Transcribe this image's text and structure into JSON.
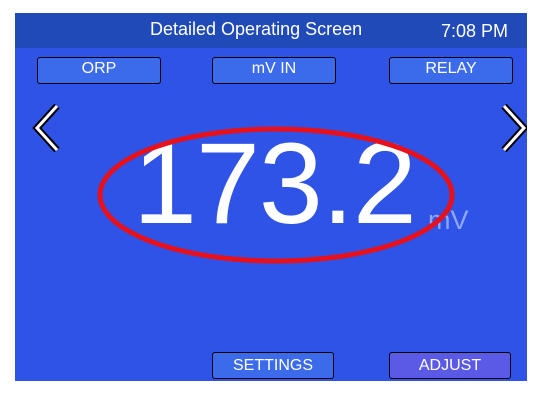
{
  "header": {
    "title": "Detailed Operating Screen",
    "time": "7:08 PM"
  },
  "tabs": [
    {
      "label": "ORP"
    },
    {
      "label": "mV IN"
    },
    {
      "label": "RELAY"
    }
  ],
  "navigation": {
    "prev_icon": "chevron-left-icon",
    "next_icon": "chevron-right-icon"
  },
  "reading": {
    "value": "173.2",
    "unit": "mV"
  },
  "annotation": {
    "shape": "ellipse",
    "color": "#e8101a"
  },
  "footer": {
    "settings_label": "SETTINGS",
    "adjust_label": "ADJUST"
  },
  "colors": {
    "screen_background": "#2e53e6",
    "title_bar": "#1f4ab8",
    "button": "#3b6bea",
    "adjust_button": "#5b5ae6",
    "unit_text": "#8fa8ff"
  }
}
